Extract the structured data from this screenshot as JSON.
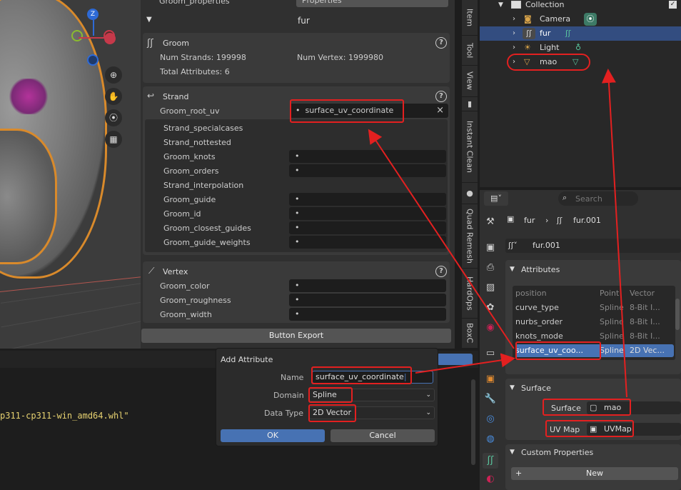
{
  "viewport": {
    "gizmo": {
      "z": "Z"
    },
    "tool_icons": [
      "zoom-icon",
      "hand-icon",
      "camera-icon",
      "grid-icon"
    ]
  },
  "props_panel": {
    "top_row": {
      "label": "Groom_properties",
      "value": "Properties"
    },
    "header_label": "fur",
    "groom": {
      "title": "Groom",
      "num_strands": "Num Strands: 199998",
      "num_vertex": "Num Vertex: 1999980",
      "total_attributes": "Total Attributes: 6",
      "help": "?"
    },
    "strand": {
      "title": "Strand",
      "help": "?",
      "root_uv_label": "Groom_root_uv",
      "root_uv_value": "surface_uv_coordinate",
      "root_uv_clear": "×",
      "rows": [
        {
          "label": "Strand_specialcases",
          "value": ""
        },
        {
          "label": "Strand_nottested",
          "value": ""
        },
        {
          "label": "Groom_knots",
          "value": "•"
        },
        {
          "label": "Groom_orders",
          "value": "•"
        },
        {
          "label": "Strand_interpolation",
          "value": ""
        },
        {
          "label": "Groom_guide",
          "value": "•"
        },
        {
          "label": "Groom_id",
          "value": "•"
        },
        {
          "label": "Groom_closest_guides",
          "value": "•"
        },
        {
          "label": "Groom_guide_weights",
          "value": "•"
        }
      ]
    },
    "vertex": {
      "title": "Vertex",
      "help": "?",
      "rows": [
        {
          "label": "Groom_color",
          "value": "•"
        },
        {
          "label": "Groom_roughness",
          "value": "•"
        },
        {
          "label": "Groom_width",
          "value": "•"
        }
      ]
    },
    "export_button": "Button Export"
  },
  "npanel_tabs": [
    "Item",
    "Tool",
    "View",
    "Instant Clean",
    "Quad Remesh",
    "HardOps",
    "BoxC"
  ],
  "outliner": {
    "rows": [
      {
        "name": "Collection",
        "icon": "collection-icon"
      },
      {
        "name": "Camera",
        "icon": "camera-icon"
      },
      {
        "name": "fur",
        "icon": "curves-icon"
      },
      {
        "name": "Light",
        "icon": "light-icon"
      },
      {
        "name": "mao",
        "icon": "mesh-icon"
      }
    ]
  },
  "properties": {
    "search_placeholder": "Search",
    "breadcrumb": {
      "object": "fur",
      "data": "fur.001"
    },
    "datablock_name": "fur.001",
    "attributes": {
      "title": "Attributes",
      "columns": [
        "position",
        "Point",
        "Vector"
      ],
      "rows": [
        {
          "name": "position",
          "domain": "Point",
          "type": "Vector"
        },
        {
          "name": "curve_type",
          "domain": "Spline",
          "type": "8-Bit I..."
        },
        {
          "name": "nurbs_order",
          "domain": "Spline",
          "type": "8-Bit I..."
        },
        {
          "name": "knots_mode",
          "domain": "Spline",
          "type": "8-Bit I..."
        },
        {
          "name": "surface_uv_coo...",
          "domain": "Spline",
          "type": "2D Vec..."
        }
      ]
    },
    "surface": {
      "title": "Surface",
      "surface_label": "Surface",
      "surface_value": "mao",
      "uvmap_label": "UV Map",
      "uvmap_value": "UVMap"
    },
    "custom_properties": {
      "title": "Custom Properties",
      "new_button": "New",
      "plus": "+"
    }
  },
  "console": {
    "text": "p311-cp311-win_amd64.whl\""
  },
  "dialog": {
    "title": "Add Attribute",
    "name_label": "Name",
    "name_value": "surface_uv_coordinate",
    "domain_label": "Domain",
    "domain_value": "Spline",
    "datatype_label": "Data Type",
    "datatype_value": "2D Vector",
    "ok": "OK",
    "cancel": "Cancel"
  },
  "colors": {
    "annotation_red": "#e32020",
    "selection_blue": "#4772b3",
    "groom_orange": "#d98a2b"
  }
}
